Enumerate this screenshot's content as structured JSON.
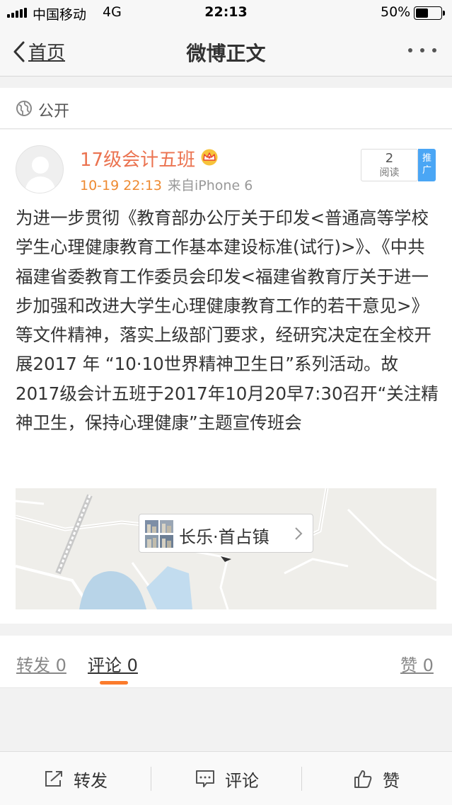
{
  "status_bar": {
    "carrier": "中国移动",
    "network": "4G",
    "time": "22:13",
    "battery_percent": "50%",
    "battery_level": 0.5
  },
  "nav": {
    "back_label": "首页",
    "title": "微博正文"
  },
  "visibility": {
    "label": "公开"
  },
  "post": {
    "username": "17级会计五班",
    "timestamp": "10-19 22:13",
    "source": "来自iPhone 6",
    "read_count": "2",
    "read_label": "阅读",
    "promote_label": "推广",
    "text": "为进一步贯彻《教育部办公厅关于印发<普通高等学校学生心理健康教育工作基本建设标准(试行)>》、《中共福建省委教育工作委员会印发<福建省教育厅关于进一步加强和改进大学生心理健康教育工作的若干意见>》等文件精神，落实上级部门要求，经研究决定在全校开展2017 年 “10·10世界精神卫生日”系列活动。故2017级会计五班于2017年10月20早7:30召开“关注精神卫生，保持心理健康”主题宣传班会",
    "location": "长乐·首占镇"
  },
  "tabs": {
    "repost": "转发 0",
    "comment": "评论 0",
    "like": "赞 0"
  },
  "toolbar": {
    "repost": "转发",
    "comment": "评论",
    "like": "赞"
  },
  "colors": {
    "username": "#eb7350",
    "timestamp": "#ee8a31",
    "promote": "#4aa6f5",
    "tab_indicator": "#fb7b2c"
  }
}
